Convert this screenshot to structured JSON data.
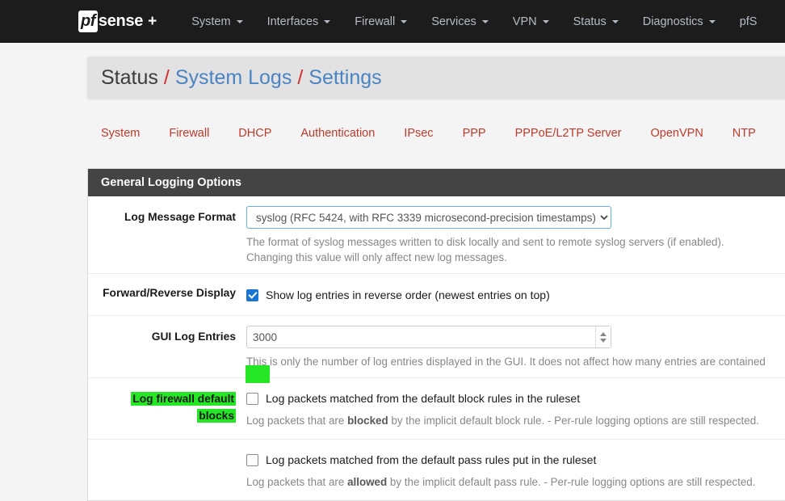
{
  "navbar": {
    "brand": {
      "pf": "pf",
      "sense": "sense",
      "plus": "+"
    },
    "items": [
      {
        "label": "System",
        "has_caret": true
      },
      {
        "label": "Interfaces",
        "has_caret": true
      },
      {
        "label": "Firewall",
        "has_caret": true
      },
      {
        "label": "Services",
        "has_caret": true
      },
      {
        "label": "VPN",
        "has_caret": true
      },
      {
        "label": "Status",
        "has_caret": true
      },
      {
        "label": "Diagnostics",
        "has_caret": true
      },
      {
        "label": "pfS",
        "has_caret": false
      }
    ]
  },
  "breadcrumb": {
    "root": "Status",
    "sep1": "/",
    "link1": "System Logs",
    "sep2": "/",
    "link2": "Settings"
  },
  "tabs": [
    {
      "label": "System"
    },
    {
      "label": "Firewall"
    },
    {
      "label": "DHCP"
    },
    {
      "label": "Authentication"
    },
    {
      "label": "IPsec"
    },
    {
      "label": "PPP"
    },
    {
      "label": "PPPoE/L2TP Server"
    },
    {
      "label": "OpenVPN"
    },
    {
      "label": "NTP"
    }
  ],
  "panel": {
    "heading": "General Logging Options",
    "rows": {
      "log_message_format": {
        "label": "Log Message Format",
        "selected": "syslog (RFC 5424, with RFC 3339 microsecond-precision timestamps)",
        "help_line1": "The format of syslog messages written to disk locally and sent to remote syslog servers (if enabled).",
        "help_line2": "Changing this value will only affect new log messages."
      },
      "forward_reverse": {
        "label": "Forward/Reverse Display",
        "checkbox_label": "Show log entries in reverse order (newest entries on top)",
        "checked": true
      },
      "gui_log_entries": {
        "label": "GUI Log Entries",
        "value": "3000",
        "help": "This is only the number of log entries displayed in the GUI. It does not affect how many entries are contained"
      },
      "default_blocks": {
        "label": "Log firewall default blocks",
        "label_line1": "Log firewall default",
        "label_line2": "blocks",
        "checkbox_label": "Log packets matched from the default block rules in the ruleset",
        "checked": false,
        "help_pre": "Log packets that are ",
        "help_bold": "blocked",
        "help_post": " by the implicit default block rule. - Per-rule logging options are still respected."
      },
      "default_pass": {
        "checkbox_label": "Log packets matched from the default pass rules put in the ruleset",
        "checked": false,
        "help_pre": "Log packets that are ",
        "help_bold": "allowed",
        "help_post": " by the implicit default pass rule. - Per-rule logging options are still respected."
      }
    }
  },
  "colors": {
    "navbar_bg": "#1c1c1c",
    "breadcrumb_link": "#4a84c4",
    "breadcrumb_sep": "#d03030",
    "tab_text": "#c0392b",
    "panel_heading_bg": "#444444",
    "checkbox_checked": "#1a74d4",
    "highlight": "#25e625",
    "focus_border": "#66afe9"
  }
}
